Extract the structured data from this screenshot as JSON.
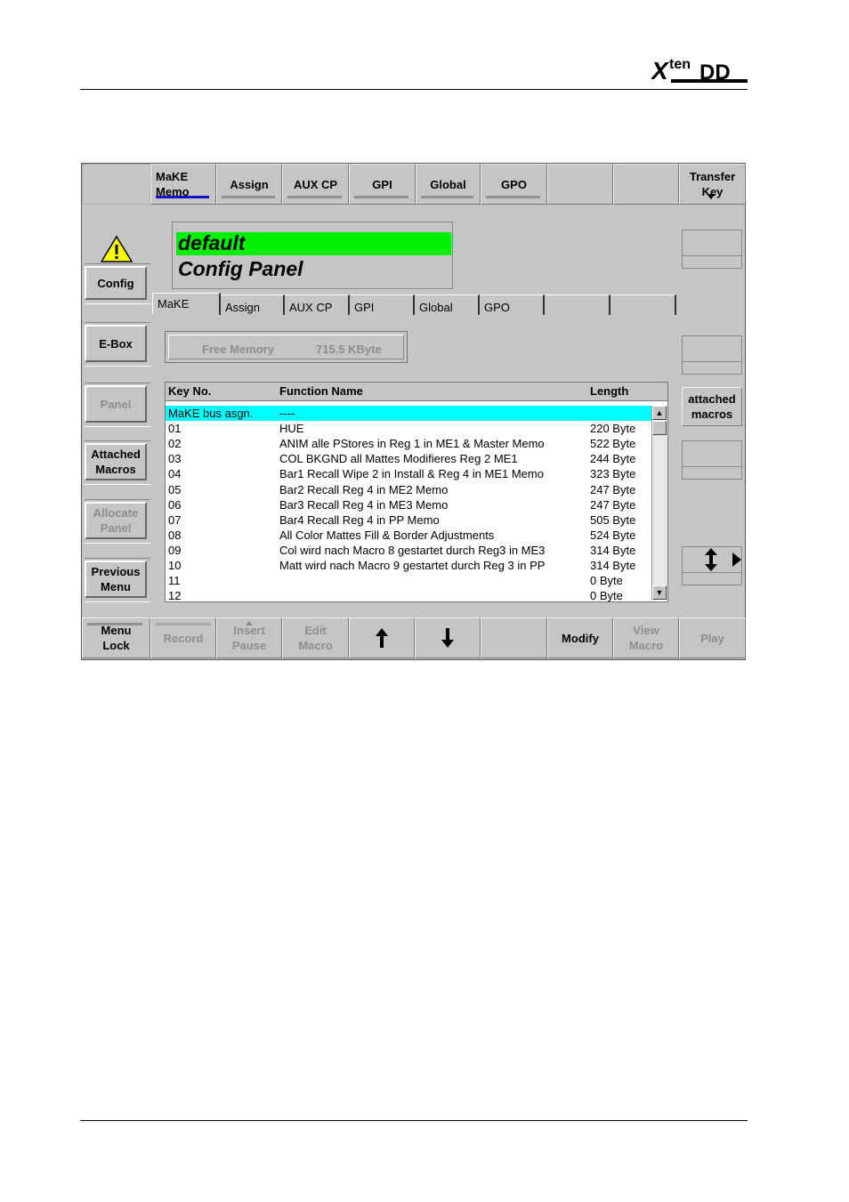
{
  "logo": "XtenDD",
  "top_tabs": [
    {
      "label": "MaKE\nMemo",
      "active": true
    },
    {
      "label": "Assign"
    },
    {
      "label": "AUX CP"
    },
    {
      "label": "GPI"
    },
    {
      "label": "Global"
    },
    {
      "label": "GPO"
    },
    {
      "label": ""
    },
    {
      "label": ""
    },
    {
      "label": "Transfer\nKey"
    }
  ],
  "sidebar": {
    "config": "Config",
    "ebox": "E-Box",
    "panel": "Panel",
    "attached_macros": "Attached\nMacros",
    "allocate_panel": "Allocate\nPanel",
    "previous_menu": "Previous\nMenu"
  },
  "title": {
    "line1": "default",
    "line2": "Config Panel"
  },
  "inner_tabs": [
    "MaKE",
    "Assign",
    "AUX CP",
    "GPI",
    "Global",
    "GPO",
    "",
    ""
  ],
  "memory": {
    "label": "Free Memory",
    "value": "715.5 KByte"
  },
  "table": {
    "headers": [
      "Key No.",
      "Function Name",
      "Length"
    ],
    "rows": [
      [
        "MaKE bus asgn.",
        "----",
        ""
      ],
      [
        "01",
        "HUE",
        "220 Byte"
      ],
      [
        "02",
        "ANIM alle PStores in Reg 1 in ME1 & Master Memo",
        "522 Byte"
      ],
      [
        "03",
        "COL BKGND all Mattes Modifieres Reg 2 ME1",
        "244 Byte"
      ],
      [
        "04",
        "Bar1 Recall Wipe 2 in Install & Reg 4 in ME1 Memo",
        "323 Byte"
      ],
      [
        "05",
        "Bar2 Recall Reg 4 in ME2 Memo",
        "247 Byte"
      ],
      [
        "06",
        "Bar3 Recall Reg 4 in ME3 Memo",
        "247 Byte"
      ],
      [
        "07",
        "Bar4 Recall Reg 4 in PP Memo",
        "505 Byte"
      ],
      [
        "08",
        "All Color Mattes Fill & Border Adjustments",
        "524 Byte"
      ],
      [
        "09",
        "Col wird nach Macro 8 gestartet durch Reg3 in ME3",
        "314 Byte"
      ],
      [
        "10",
        "Matt wird nach Macro 9 gestartet durch Reg 3 in PP",
        "314 Byte"
      ],
      [
        "11",
        "",
        "0 Byte"
      ],
      [
        "12",
        "",
        "0 Byte"
      ]
    ]
  },
  "right": {
    "attached_macros": "attached\nmacros",
    "updown_icon": "up-down-arrow-icon",
    "right_icon": "triangle-right-icon"
  },
  "bottom_bar": [
    {
      "label": "Menu\nLock",
      "enabled": true
    },
    {
      "label": "Record",
      "enabled": false
    },
    {
      "label": "Insert\nPause",
      "enabled": false
    },
    {
      "label": "Edit\nMacro",
      "enabled": false
    },
    {
      "label": "",
      "icon": "arrow-up-icon",
      "enabled": true
    },
    {
      "label": "",
      "icon": "arrow-down-icon",
      "enabled": true
    },
    {
      "label": "",
      "enabled": true
    },
    {
      "label": "Modify",
      "enabled": true
    },
    {
      "label": "View\nMacro",
      "enabled": false
    },
    {
      "label": "Play",
      "enabled": false
    }
  ],
  "colors": {
    "panel": "#c5c5c5",
    "title_highlight": "#00f000",
    "selected_row": "#00ffff",
    "active_tab_underline": "#1010c8"
  }
}
